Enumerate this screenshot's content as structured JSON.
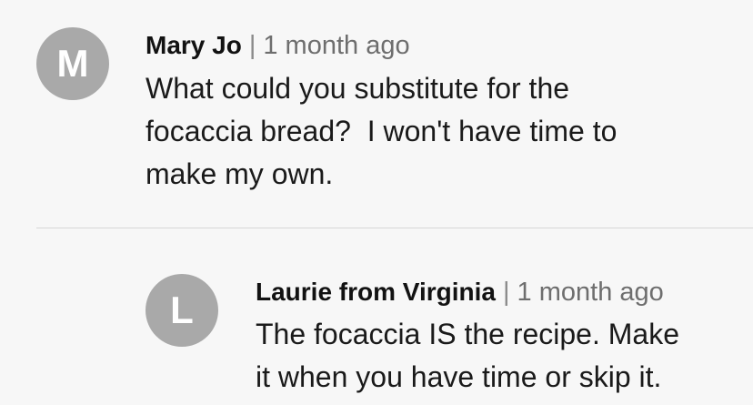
{
  "comments": [
    {
      "avatar_initial": "M",
      "author": "Mary Jo",
      "separator": "|",
      "time": "1 month ago",
      "lines": [
        "What could you substitute for the",
        "focaccia bread?  I won't have time to",
        "make my own."
      ]
    },
    {
      "avatar_initial": "L",
      "author": "Laurie from Virginia",
      "separator": "|",
      "time": "1 month ago",
      "lines": [
        "The focaccia IS the recipe. Make",
        "it when you have time or skip it."
      ]
    }
  ]
}
